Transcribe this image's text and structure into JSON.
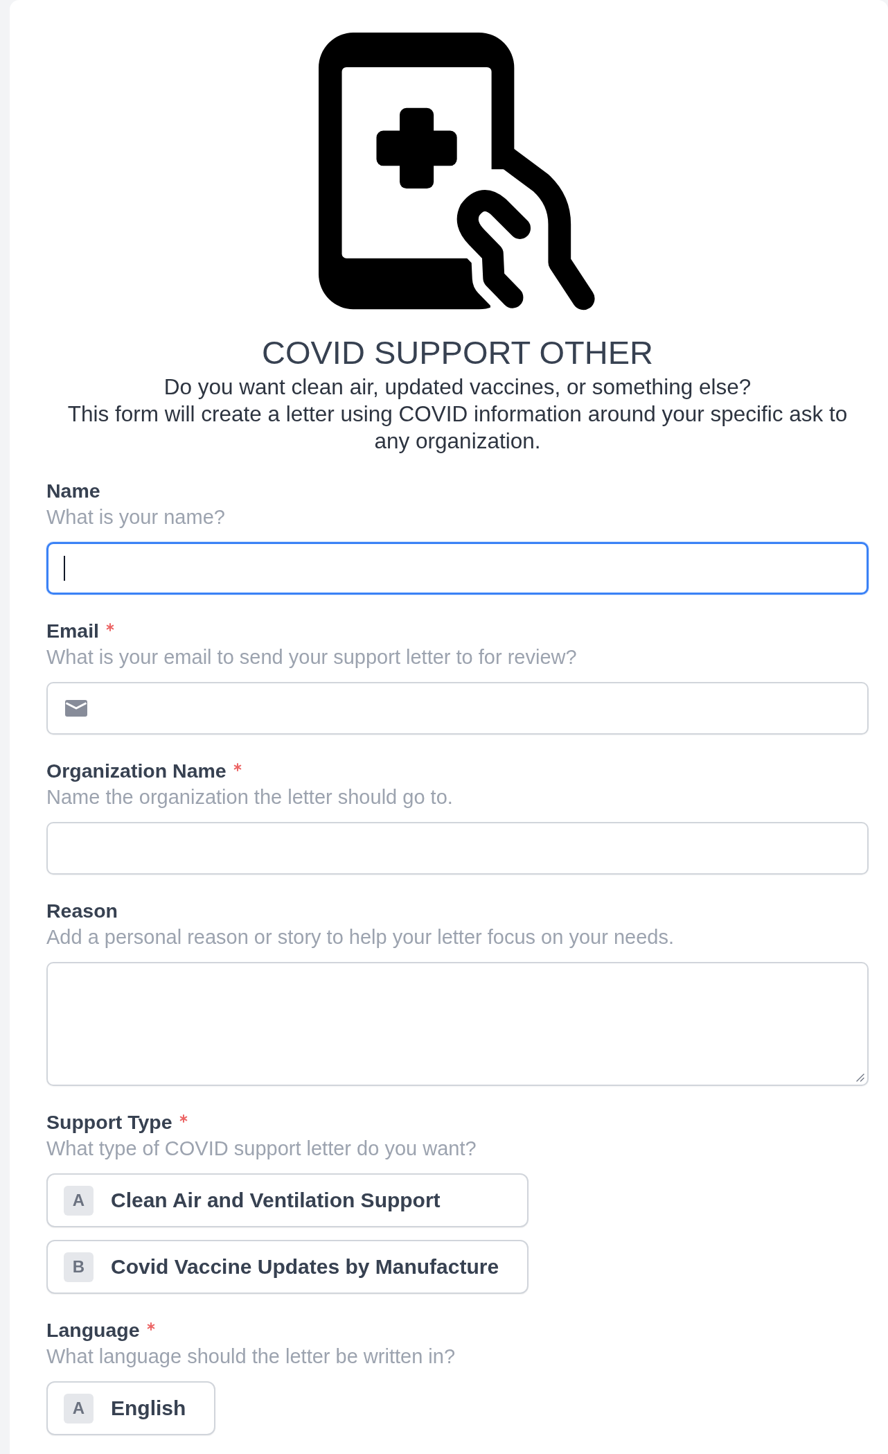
{
  "header": {
    "title": "COVID SUPPORT OTHER",
    "description": [
      "Do you want clean air, updated vaccines, or something else?",
      "This form will create a letter using COVID information around your specific ask to any organization."
    ]
  },
  "fields": [
    {
      "kind": "text",
      "label": "Name",
      "required": false,
      "description": "What is your name?",
      "focused": true
    },
    {
      "kind": "email",
      "label": "Email",
      "required": true,
      "description": "What is your email to send your support letter to for review?",
      "focused": false
    },
    {
      "kind": "text",
      "label": "Organization Name",
      "required": true,
      "description": "Name the organization the letter should go to.",
      "focused": false
    },
    {
      "kind": "textarea",
      "label": "Reason",
      "required": false,
      "description": "Add a personal reason or story to help your letter focus on your needs.",
      "focused": false
    },
    {
      "kind": "choice",
      "label": "Support Type",
      "required": true,
      "description": "What type of COVID support letter do you want?",
      "options": [
        {
          "key": "A",
          "label": "Clean Air and Ventilation Support",
          "selected": false
        },
        {
          "key": "B",
          "label": "Covid Vaccine Updates by Manufacture",
          "selected": false
        }
      ]
    },
    {
      "kind": "choice",
      "label": "Language",
      "required": true,
      "description": "What language should the letter be written in?",
      "options": [
        {
          "key": "A",
          "label": "English",
          "selected": false
        }
      ]
    }
  ]
}
